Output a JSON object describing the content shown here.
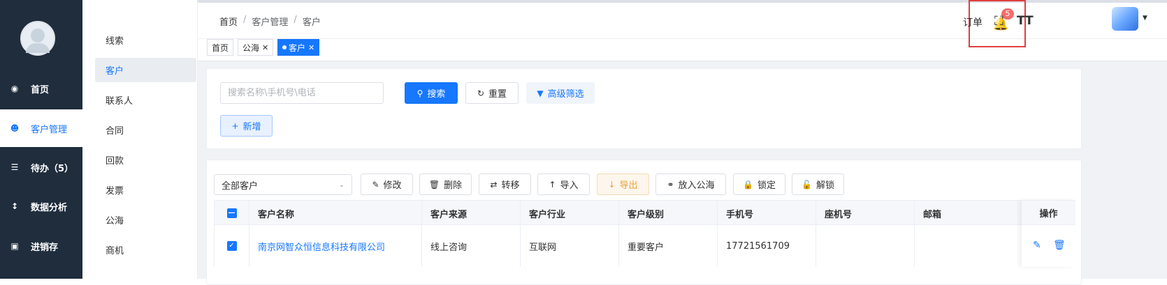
{
  "sidebar": {
    "items": [
      {
        "label": "首页",
        "icon": "dashboard-icon"
      },
      {
        "label": "客户管理",
        "icon": "users-icon"
      },
      {
        "label": "待办（5）",
        "icon": "sliders-icon"
      },
      {
        "label": "数据分析",
        "icon": "chart-icon"
      },
      {
        "label": "进销存",
        "icon": "window-icon"
      }
    ]
  },
  "submenu": {
    "items": [
      "线索",
      "客户",
      "联系人",
      "合同",
      "回款",
      "发票",
      "公海",
      "商机"
    ]
  },
  "topbar": {
    "breadcrumb": [
      "首页",
      "客户管理",
      "客户"
    ],
    "badge_count": "5",
    "order_label": "订单"
  },
  "tags": [
    {
      "label": "首页"
    },
    {
      "label": "公海"
    },
    {
      "label": "客户"
    }
  ],
  "search": {
    "placeholder": "搜索名称\\手机号\\电话",
    "search_label": "搜索",
    "reset_label": "重置",
    "filter_label": "高级筛选",
    "add_label": "新增"
  },
  "toolbar": {
    "select_value": "全部客户",
    "edit_label": "修改",
    "delete_label": "删除",
    "transfer_label": "转移",
    "import_label": "导入",
    "export_label": "导出",
    "to_pool_label": "放入公海",
    "lock_label": "锁定",
    "unlock_label": "解锁"
  },
  "table": {
    "columns": [
      "客户名称",
      "客户来源",
      "客户行业",
      "客户级别",
      "手机号",
      "座机号",
      "邮箱"
    ],
    "action_header": "操作",
    "rows": [
      {
        "name": "南京网智众恒信息科技有限公司",
        "source": "线上咨询",
        "industry": "互联网",
        "level": "重要客户",
        "mobile": "17721561709",
        "phone": "",
        "email": ""
      }
    ]
  }
}
